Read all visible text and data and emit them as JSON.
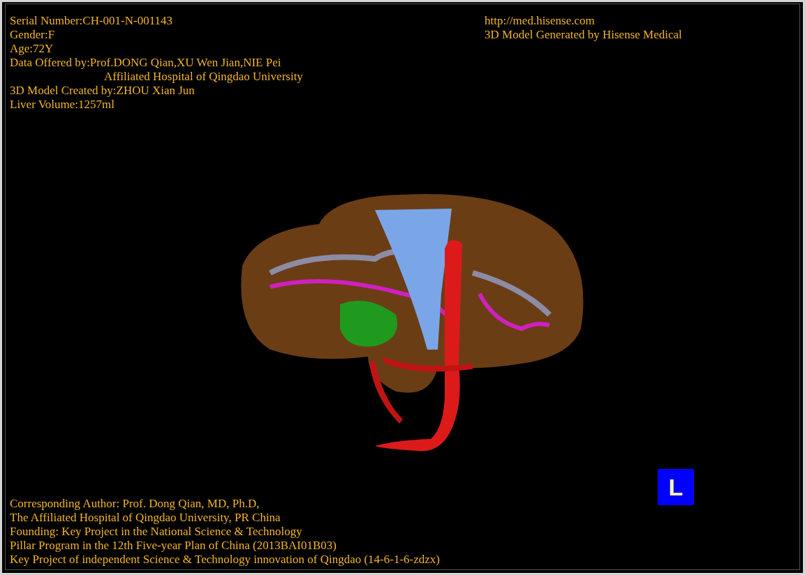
{
  "info_left": [
    {
      "text": "Serial Number:CH-001-N-001143",
      "kind": "line"
    },
    {
      "text": "Gender:F",
      "kind": "line"
    },
    {
      "text": "Age:72Y",
      "kind": "line"
    },
    {
      "text": "Data Offered by:Prof.DONG Qian,XU Wen Jian,NIE Pei",
      "kind": "line"
    },
    {
      "text": "Affiliated Hospital of Qingdao University",
      "kind": "continuation"
    },
    {
      "text": "3D Model Created by:ZHOU Xian Jun",
      "kind": "line"
    },
    {
      "text": "Liver Volume:1257ml",
      "kind": "line"
    }
  ],
  "info_right": [
    "http://med.hisense.com",
    "3D Model Generated by Hisense Medical"
  ],
  "footer": [
    "Corresponding Author: Prof. Dong Qian, MD, Ph.D,",
    "The Affiliated Hospital of Qingdao University, PR China",
    "Founding: Key Project in the National Science & Technology",
    "Pillar Program in the 12th Five-year Plan of China (2013BAI01B03)",
    "Key Project of independent Science & Technology innovation of Qingdao (14-6-1-6-zdzx)"
  ],
  "orientation_marker": "L"
}
